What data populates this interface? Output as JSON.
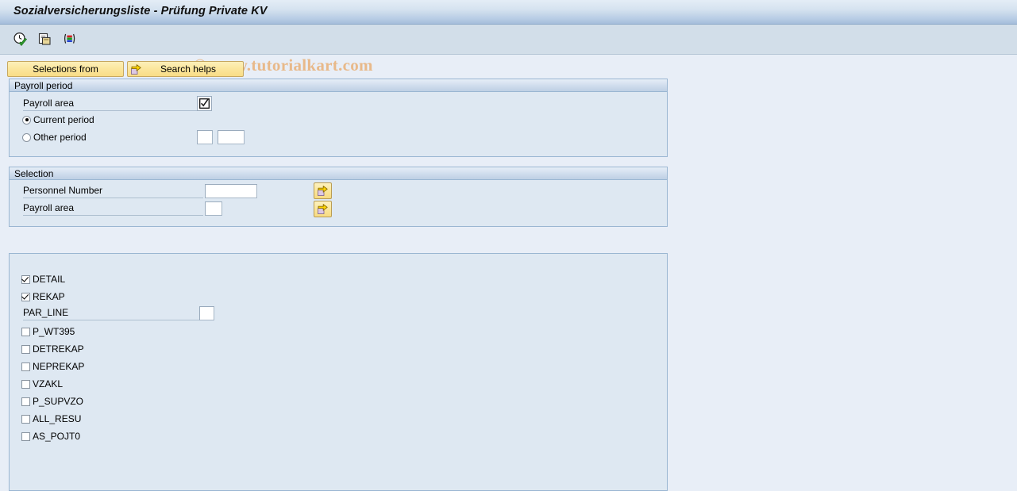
{
  "window": {
    "title": "Sozialversicherungsliste - Prüfung Private KV"
  },
  "watermark": {
    "text": "© www.tutorialkart.com"
  },
  "toolbar": {
    "icons": [
      {
        "name": "execute-clock-icon",
        "title": "Execute"
      },
      {
        "name": "copy-variant-icon",
        "title": "Get Variant"
      },
      {
        "name": "colored-list-icon",
        "title": "Selection Options"
      }
    ]
  },
  "action_bar": {
    "selections_from_label": "Selections from",
    "search_helps_label": "Search helps",
    "search_helps_icon": "yellow-arrow-icon"
  },
  "payroll_period": {
    "legend": "Payroll period",
    "payroll_area_label": "Payroll area",
    "payroll_area_toggle_icon": "checkbox-tick-icon",
    "current_period_label": "Current period",
    "other_period_label": "Other period",
    "selected_option": "current",
    "other_period_value_1": "",
    "other_period_value_2": ""
  },
  "selection": {
    "legend": "Selection",
    "rows": [
      {
        "label": "Personnel Number",
        "value": "",
        "multi_icon": "yellow-arrow-icon"
      },
      {
        "label": "Payroll area",
        "value": "",
        "multi_icon": "yellow-arrow-icon"
      }
    ]
  },
  "options_panel": {
    "items": [
      {
        "label": "DETAIL",
        "type": "checkbox",
        "checked": true
      },
      {
        "label": "REKAP",
        "type": "checkbox",
        "checked": true
      },
      {
        "label": "PAR_LINE",
        "type": "field",
        "value": ""
      },
      {
        "label": "P_WT395",
        "type": "checkbox",
        "checked": false
      },
      {
        "label": "DETREKAP",
        "type": "checkbox",
        "checked": false
      },
      {
        "label": "NEPREKAP",
        "type": "checkbox",
        "checked": false
      },
      {
        "label": "VZAKL",
        "type": "checkbox",
        "checked": false
      },
      {
        "label": "P_SUPVZO",
        "type": "checkbox",
        "checked": false
      },
      {
        "label": "ALL_RESU",
        "type": "checkbox",
        "checked": false
      },
      {
        "label": "AS_POJT0",
        "type": "checkbox",
        "checked": false
      }
    ]
  },
  "colors": {
    "title_bar_top": "#e4edf6",
    "title_bar_bottom": "#a5bddb",
    "toolbar_bg": "#d2dee9",
    "body_bg": "#e8eef7",
    "group_bg": "#dee8f2",
    "group_border": "#9ab6d2",
    "button_yellow": "#fbe69c",
    "watermark": "#e8b98a"
  }
}
